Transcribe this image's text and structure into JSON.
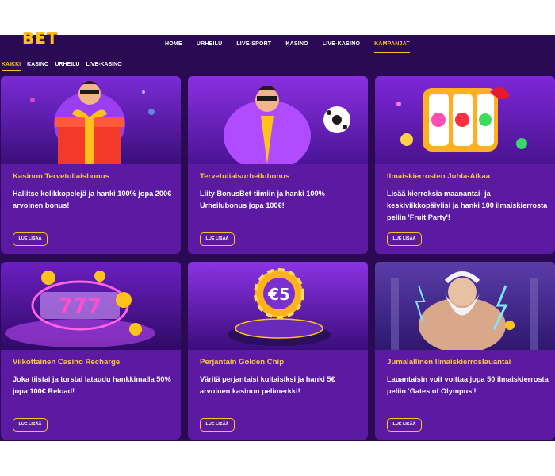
{
  "header": {
    "logo_text": "BET",
    "nav": [
      "HOME",
      "URHEILU",
      "LIVE-SPORT",
      "KASINO",
      "LIVE-KASINO",
      "KAMPANJAT"
    ],
    "active_nav": "KAMPANJAT"
  },
  "filters": {
    "items": [
      "KAIKKI",
      "KASINO",
      "URHEILU",
      "LIVE-KASINO"
    ],
    "active": "KAIKKI"
  },
  "cards": [
    {
      "title": "Kasinon Tervetuliaisbonus",
      "description": "Hallitse kolikkopelejä ja hanki 100% jopa 200€ arvoinen bonus!",
      "button": "LUE LISÄÄ",
      "image_icon": "mascot-gift-icon"
    },
    {
      "title": "Tervetuliaisurheilubonus",
      "description": "Liity BonusBet-tiimiin ja hanki 100% Urheilubonus jopa 100€!",
      "button": "LUE LISÄÄ",
      "image_icon": "mascot-football-icon"
    },
    {
      "title": "Ilmaiskierrosten Juhla-Aikaa",
      "description": "Lisää kierroksia maanantai- ja keskiviikkopäiviisi ja hanki 100 ilmaiskierrosta peliin 'Fruit Party'!",
      "button": "LUE LISÄÄ",
      "image_icon": "fruit-slot-icon"
    },
    {
      "title": "Viikottainen Casino Recharge",
      "description": "Joka tiistai ja torstai lataudu hankkimalla 50% jopa 100€ Reload!",
      "button": "LUE LISÄÄ",
      "image_icon": "slot-777-icon"
    },
    {
      "title": "Perjantain Golden Chip",
      "description": "Väritä perjantaisi kultaisiksi ja hanki 5€ arvoinen kasinon pelimerkki!",
      "button": "LUE LISÄÄ",
      "image_icon": "golden-chip-icon"
    },
    {
      "title": "Jumalallinen Ilmaiskierroslauantai",
      "description": "Lauantaisin voit voittaa jopa 50 ilmaiskierrosta peliin 'Gates of Olympus'!",
      "button": "LUE LISÄÄ",
      "image_icon": "zeus-icon"
    }
  ],
  "chip_label": "€5",
  "slot_label": "777",
  "colors": {
    "background": "#2a0a52",
    "card": "#5b1aa1",
    "accent": "#ffc21a",
    "title": "#f8c93a"
  }
}
